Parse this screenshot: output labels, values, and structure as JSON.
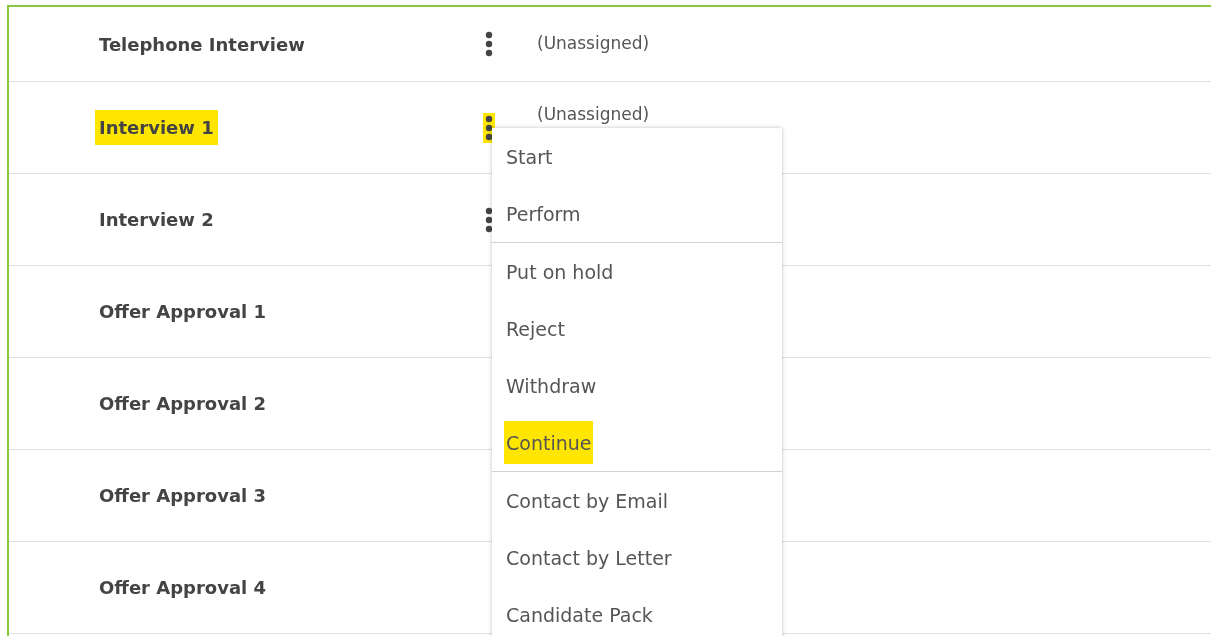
{
  "rows": [
    {
      "name": "Telephone Interview",
      "highlighted": false,
      "menu_button_highlighted": false,
      "assignee": "(Unassigned)"
    },
    {
      "name": "Interview 1",
      "highlighted": true,
      "menu_button_highlighted": true,
      "assignee": "(Unassigned)",
      "menu_open": true
    },
    {
      "name": "Interview 2",
      "highlighted": false,
      "menu_button_highlighted": false
    },
    {
      "name": "Offer Approval 1",
      "highlighted": false
    },
    {
      "name": "Offer Approval 2",
      "highlighted": false
    },
    {
      "name": "Offer Approval 3",
      "highlighted": false
    },
    {
      "name": "Offer Approval 4",
      "highlighted": false
    }
  ],
  "menu": {
    "groups": [
      [
        {
          "label": "Start",
          "highlighted": false
        },
        {
          "label": "Perform",
          "highlighted": false
        }
      ],
      [
        {
          "label": "Put on hold",
          "highlighted": false
        },
        {
          "label": "Reject",
          "highlighted": false
        },
        {
          "label": "Withdraw",
          "highlighted": false
        },
        {
          "label": "Continue",
          "highlighted": true
        }
      ],
      [
        {
          "label": "Contact by Email",
          "highlighted": false
        },
        {
          "label": "Contact by Letter",
          "highlighted": false
        },
        {
          "label": "Candidate Pack",
          "highlighted": false
        }
      ]
    ]
  }
}
